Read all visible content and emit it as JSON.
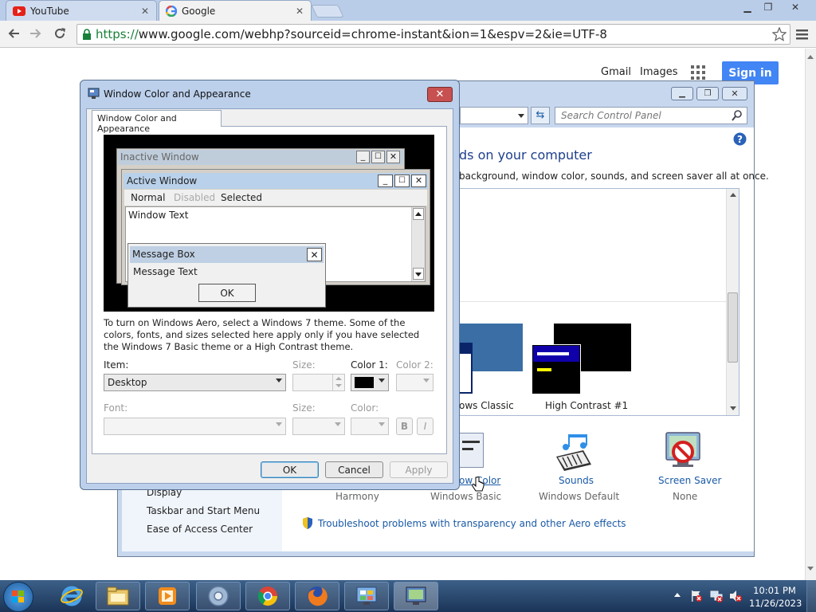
{
  "browser": {
    "tabs": [
      {
        "title": "YouTube",
        "active": false,
        "icon": "youtube-icon"
      },
      {
        "title": "Google",
        "active": true,
        "icon": "google-g-icon"
      }
    ],
    "url_scheme": "https://",
    "url_rest": "www.google.com/webhp?sourceid=chrome-instant&ion=1&espv=2&ie=UTF-8"
  },
  "google": {
    "gmail": "Gmail",
    "images": "Images",
    "sign_in": "Sign in"
  },
  "control_panel": {
    "search_placeholder": "Search Control Panel",
    "heading": "ds on your computer",
    "subtext": "background, window color, sounds, and screen saver all at once.",
    "themes": [
      {
        "label": "ows Classic"
      },
      {
        "label": "High Contrast #1"
      }
    ],
    "items": [
      {
        "label": "ow Color",
        "sub": "Windows Basic",
        "icon": "window-color-icon"
      },
      {
        "label": "Sounds",
        "sub": "Windows Default",
        "icon": "sounds-icon"
      },
      {
        "label": "Screen Saver",
        "sub": "None",
        "icon": "screen-saver-icon"
      }
    ],
    "harmony": "Harmony",
    "nav_links": [
      "Display",
      "Taskbar and Start Menu",
      "Ease of Access Center"
    ],
    "troubleshoot": "Troubleshoot problems with transparency and other Aero effects"
  },
  "dialog": {
    "title": "Window Color and Appearance",
    "tab": "Window Color and Appearance",
    "preview": {
      "inactive_window": "Inactive Window",
      "active_window": "Active Window",
      "menu_normal": "Normal",
      "menu_disabled": "Disabled",
      "menu_selected": "Selected",
      "window_text": "Window Text",
      "message_box": "Message Box",
      "message_text": "Message Text",
      "ok": "OK"
    },
    "aero_text": "To turn on Windows Aero, select a Windows 7 theme.  Some of the colors, fonts, and sizes selected here apply only if you have selected the Windows 7 Basic theme or a High Contrast theme.",
    "item_label": "Item:",
    "item_value": "Desktop",
    "size_label": "Size:",
    "color1_label": "Color 1:",
    "color1_value": "#000000",
    "color2_label": "Color 2:",
    "font_label": "Font:",
    "size2_label": "Size:",
    "color_label": "Color:",
    "bold": "B",
    "italic": "I",
    "ok": "OK",
    "cancel": "Cancel",
    "apply": "Apply"
  },
  "taskbar": {
    "time": "10:01 PM",
    "date": "11/26/2023"
  }
}
